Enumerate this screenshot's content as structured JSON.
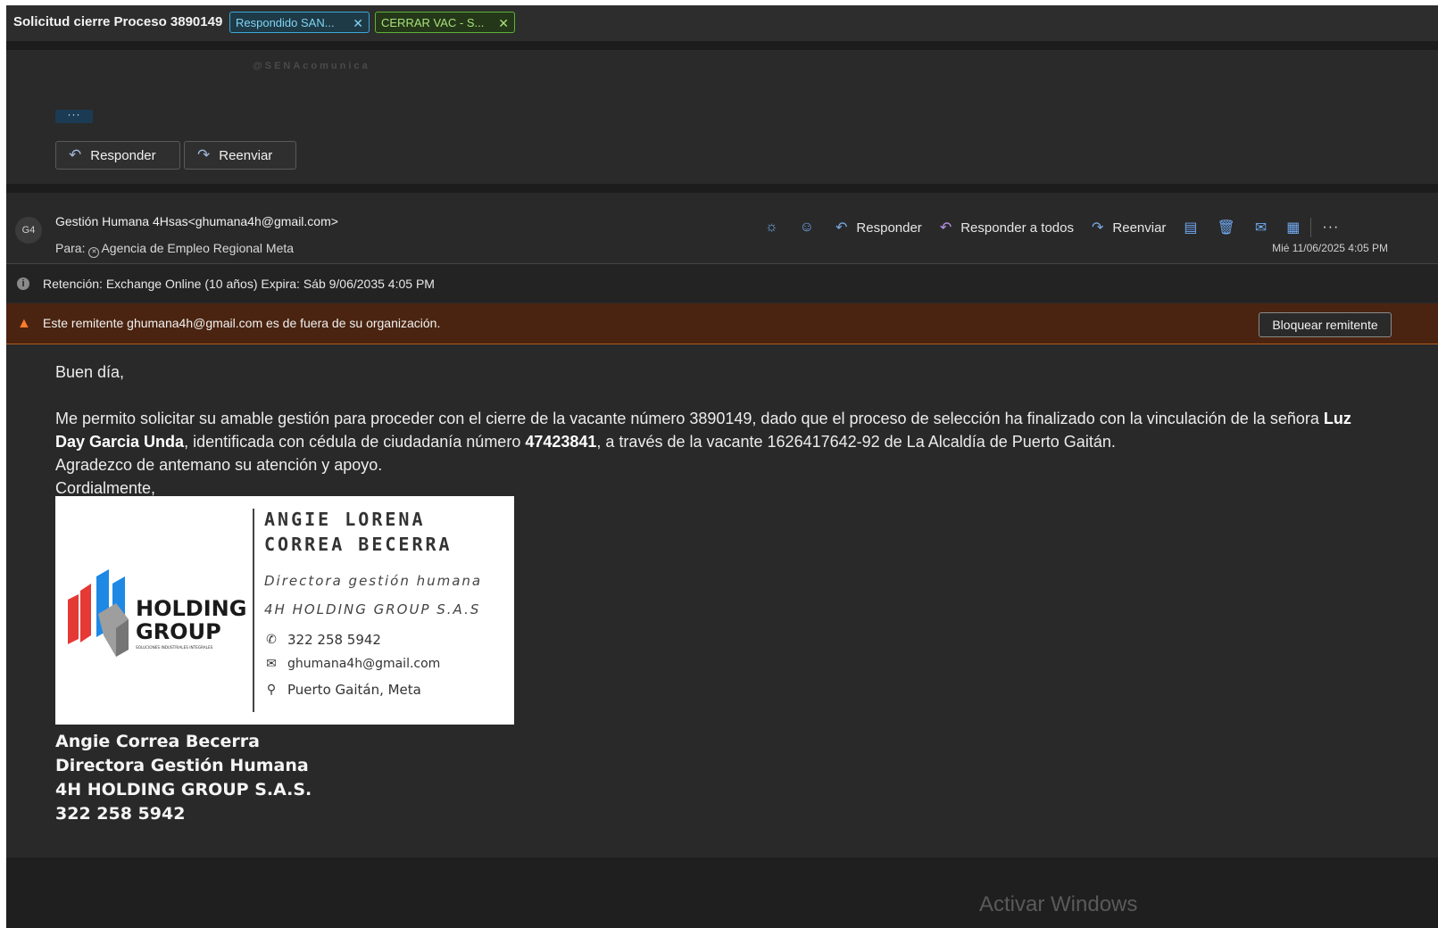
{
  "subject": {
    "title": "Solicitud cierre Proceso 3890149",
    "tags": [
      {
        "label": "Respondido SAN...",
        "color": "#3aa9d8"
      },
      {
        "label": "CERRAR VAC - S...",
        "color": "#5fb236"
      }
    ]
  },
  "previous_message": {
    "watermark": "@SENAcomunica",
    "expand_label": "···",
    "reply_label": "Responder",
    "forward_label": "Reenviar"
  },
  "message": {
    "avatar_initials": "G4",
    "sender": "Gestión Humana 4Hsas<ghumana4h@gmail.com>",
    "to_prefix": "Para:",
    "to_name": "Agencia de Empleo Regional Meta",
    "date": "Mié 11/06/2025 4:05 PM",
    "toolbar": {
      "reply": "Responder",
      "reply_all": "Responder a todos",
      "forward": "Reenviar",
      "more": "···"
    },
    "retention": "Retención: Exchange Online (10 años) Expira: Sáb 9/06/2035 4:05 PM",
    "warning": "Este remitente ghumana4h@gmail.com es de fuera de su organización.",
    "block_sender": "Bloquear remitente",
    "body": {
      "greeting": "Buen día,",
      "p1_a": "Me permito solicitar su amable gestión para proceder con el cierre de la vacante número 3890149, dado que el proceso de selección ha finalizado con la vinculación de la señora ",
      "p1_name": "Luz Day Garcia Unda",
      "p1_b": ", identificada con cédula de ciudadanía número ",
      "p1_id": "47423841",
      "p1_c": ", a través de la vacante  1626417642-92  de La Alcaldía de Puerto Gaitán.",
      "p2": "Agradezco de antemano su atención y apoyo.",
      "p3": "Cordialmente,"
    },
    "card": {
      "logo_line1": "HOLDING",
      "logo_line2": "GROUP",
      "logo_tagline": "SOLUCIONES INDUSTRIALES INTEGRALES",
      "name_line1": "ANGIE LORENA",
      "name_line2": "CORREA BECERRA",
      "role": "Directora gestión humana",
      "company": "4H HOLDING GROUP S.A.S",
      "phone": "322 258 5942",
      "email": "ghumana4h@gmail.com",
      "location": "Puerto Gaitán, Meta"
    },
    "signature": {
      "name": "Angie Correa Becerra",
      "role": "Directora Gestión Humana",
      "company": "4H HOLDING GROUP S.A.S.",
      "phone": "322 258 5942"
    }
  },
  "overlay": {
    "activate_text": "Activar Windows"
  }
}
